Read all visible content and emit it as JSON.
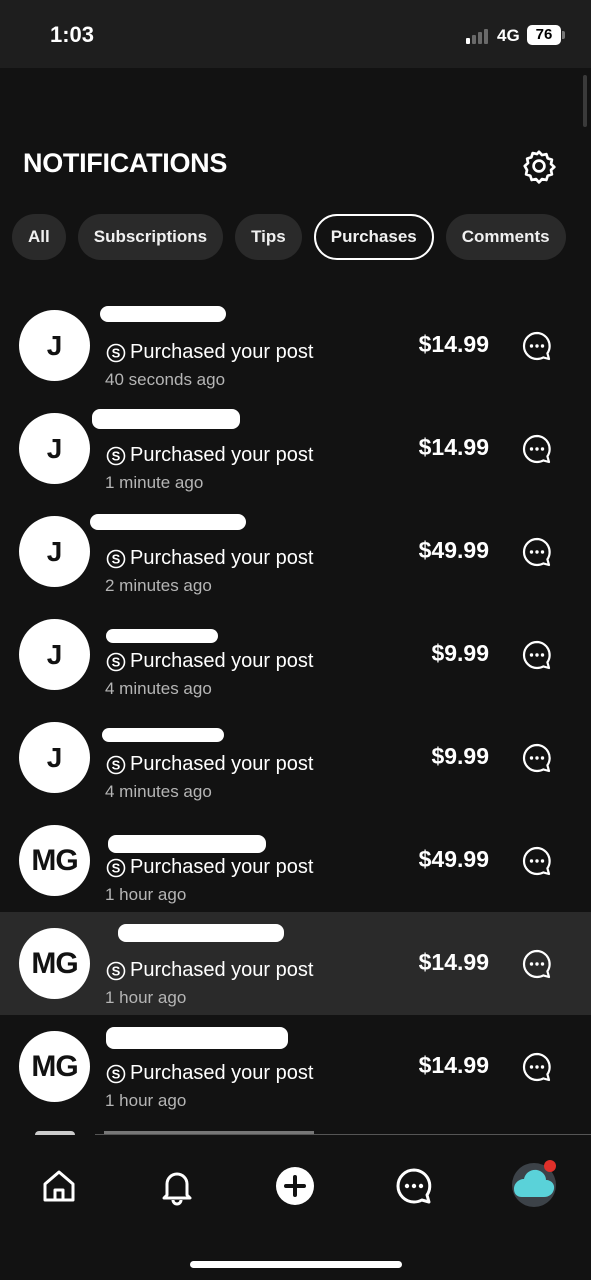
{
  "status": {
    "time": "1:03",
    "network": "4G",
    "battery": "76"
  },
  "header": {
    "title": "NOTIFICATIONS"
  },
  "tabs": [
    {
      "label": "All",
      "active": false
    },
    {
      "label": "Subscriptions",
      "active": false
    },
    {
      "label": "Tips",
      "active": false
    },
    {
      "label": "Purchases",
      "active": true
    },
    {
      "label": "Comments",
      "active": false
    }
  ],
  "notifications": [
    {
      "initials": "J",
      "action": "Purchased your post",
      "time": "40 seconds ago",
      "amount": "$14.99"
    },
    {
      "initials": "J",
      "action": "Purchased your post",
      "time": "1 minute ago",
      "amount": "$14.99"
    },
    {
      "initials": "J",
      "action": "Purchased your post",
      "time": "2 minutes ago",
      "amount": "$49.99"
    },
    {
      "initials": "J",
      "action": "Purchased your post",
      "time": "4 minutes ago",
      "amount": "$9.99"
    },
    {
      "initials": "J",
      "action": "Purchased your post",
      "time": "4 minutes ago",
      "amount": "$9.99"
    },
    {
      "initials": "MG",
      "action": "Purchased your post",
      "time": "1 hour ago",
      "amount": "$49.99"
    },
    {
      "initials": "MG",
      "action": "Purchased your post",
      "time": "1 hour ago",
      "amount": "$14.99",
      "highlighted": true
    },
    {
      "initials": "MG",
      "action": "Purchased your post",
      "time": "1 hour ago",
      "amount": "$14.99"
    }
  ],
  "icons": {
    "settings": "gear-icon",
    "purchase": "dollar-circle-icon",
    "message": "chat-bubble-icon",
    "nav": [
      "home-icon",
      "bell-icon",
      "plus-circle-icon",
      "chat-bubble-icon",
      "profile-avatar"
    ]
  },
  "colors": {
    "background": "#121212",
    "status_bar": "#1e1e1e",
    "tab_bg": "#2a2a2a",
    "highlight_row": "#2a2a2a",
    "avatar_accent": "#5ad2d9",
    "badge": "#e0302a"
  }
}
